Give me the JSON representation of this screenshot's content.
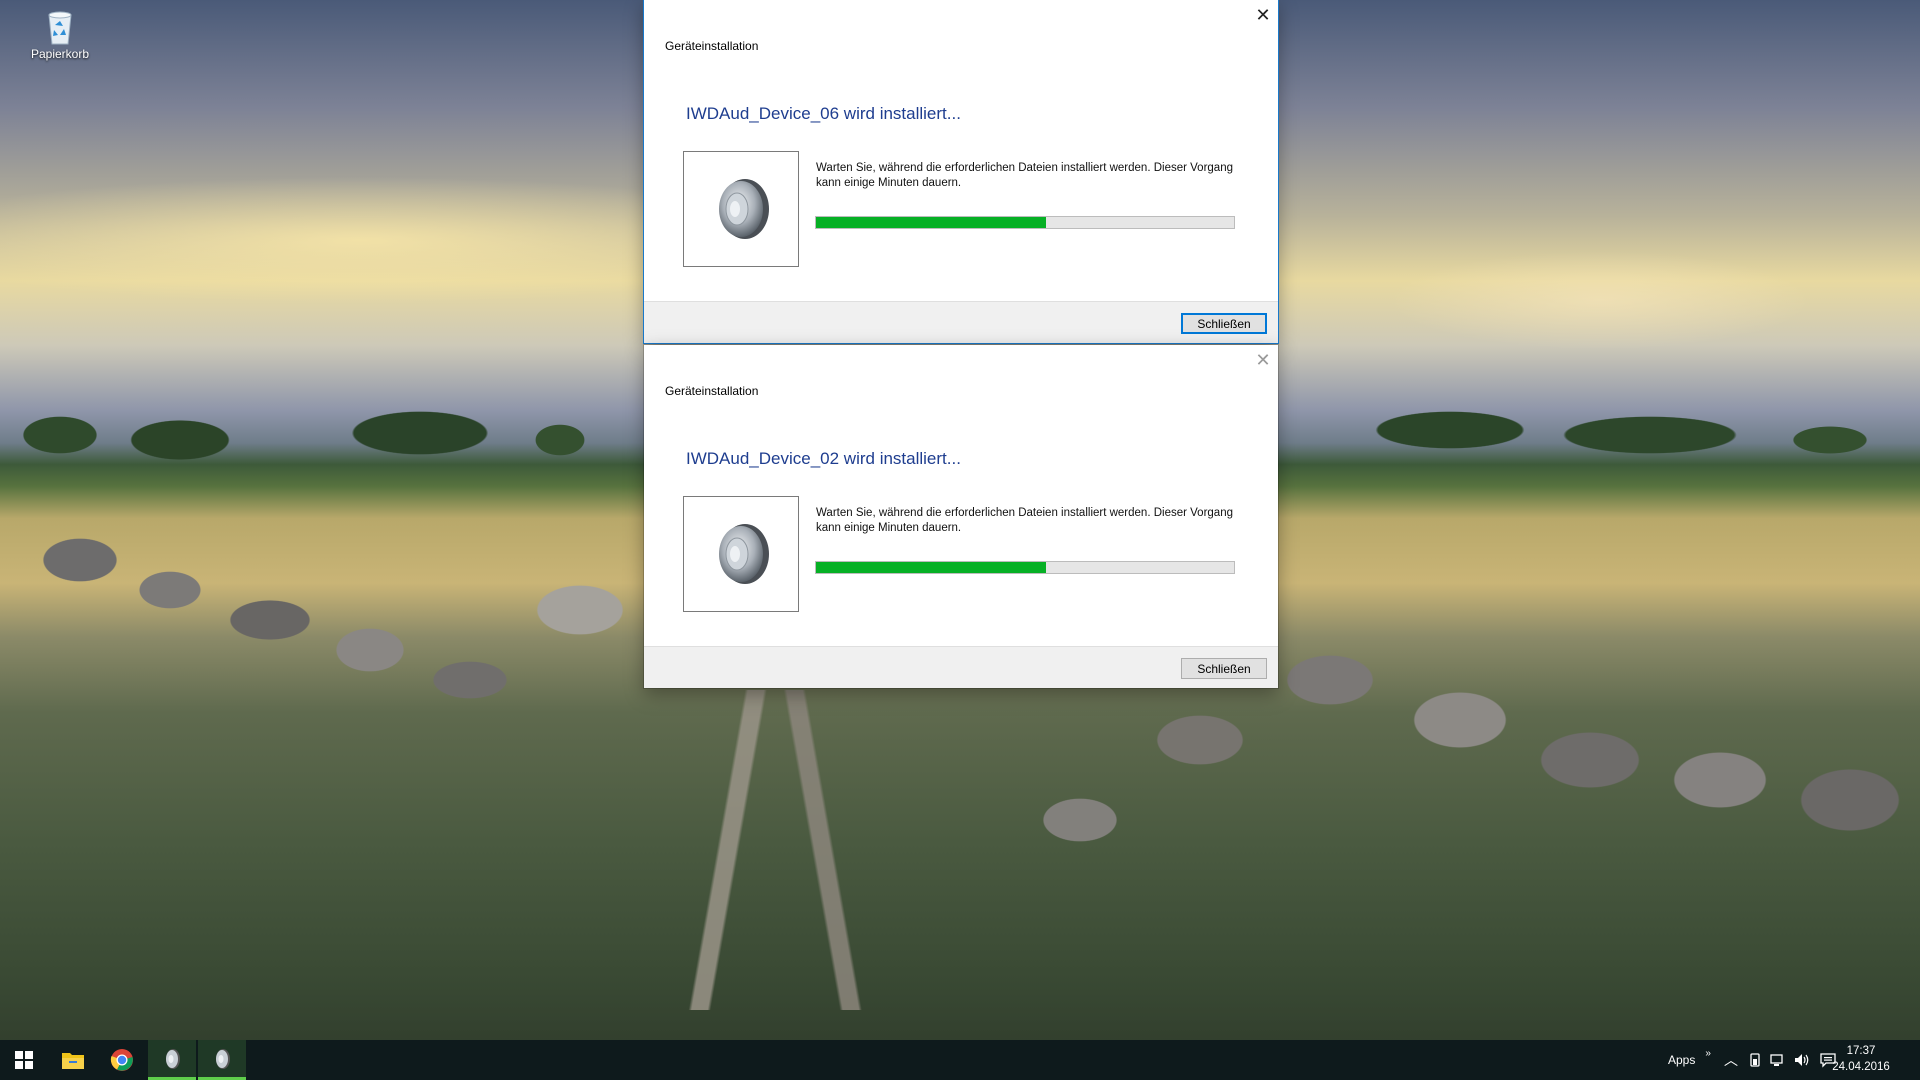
{
  "desktop": {
    "recycle_bin_label": "Papierkorb"
  },
  "dialogs": [
    {
      "title": "Geräteinstallation",
      "heading": "IWDAud_Device_06 wird installiert...",
      "description": "Warten Sie, während die erforderlichen Dateien installiert werden. Dieser Vorgang kann einige Minuten dauern.",
      "progress_percent": 55,
      "close_button_label": "Schließen",
      "state": "active"
    },
    {
      "title": "Geräteinstallation",
      "heading": "IWDAud_Device_02 wird installiert...",
      "description": "Warten Sie, während die erforderlichen Dateien installiert werden. Dieser Vorgang kann einige Minuten dauern.",
      "progress_percent": 55,
      "close_button_label": "Schließen",
      "state": "inactive"
    }
  ],
  "taskbar": {
    "apps_label": "Apps",
    "time": "17:37",
    "date": "24.04.2016",
    "items": [
      {
        "icon": "windows-start-icon"
      },
      {
        "icon": "file-explorer-icon"
      },
      {
        "icon": "chrome-icon"
      },
      {
        "icon": "speaker-device-icon"
      },
      {
        "icon": "speaker-device-icon"
      }
    ]
  },
  "colors": {
    "heading_blue": "#1e3d8f",
    "progress_green": "#06b025",
    "taskbar_bg": "#0e1a1c",
    "running_indicator": "#5fce4b",
    "focus_blue": "#0078d7"
  }
}
